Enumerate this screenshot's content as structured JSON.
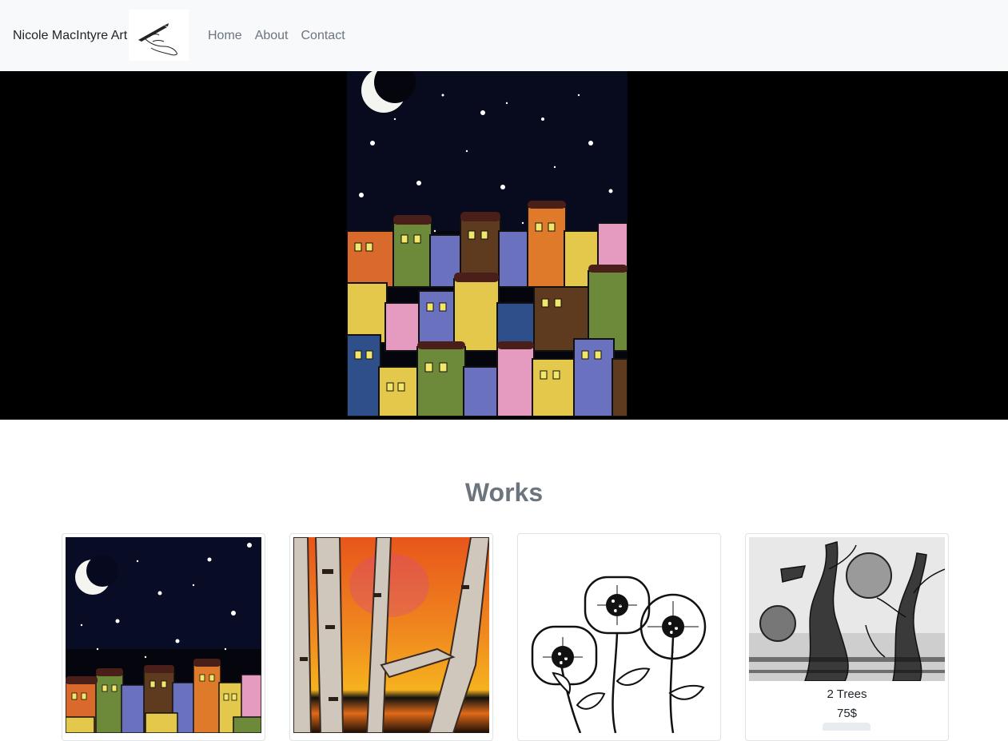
{
  "nav": {
    "brand": "Nicole MacIntyre Art",
    "logo_icon": "hand-drawing-pen-icon",
    "links": [
      "Home",
      "About",
      "Contact"
    ]
  },
  "hero": {
    "artwork": "night-village-painting"
  },
  "works": {
    "title": "Works",
    "items": [
      {
        "artwork": "night-village-painting",
        "name": "",
        "price": ""
      },
      {
        "artwork": "birch-trees-sunset-painting",
        "name": "",
        "price": ""
      },
      {
        "artwork": "ink-flowers-drawing",
        "name": "",
        "price": ""
      },
      {
        "artwork": "two-trees-ink-drawing",
        "name": "2 Trees",
        "price": "75$"
      }
    ]
  },
  "colors": {
    "navbar_bg": "#f8f9fa",
    "hero_bg": "#000000",
    "muted_text": "#6c757d"
  }
}
